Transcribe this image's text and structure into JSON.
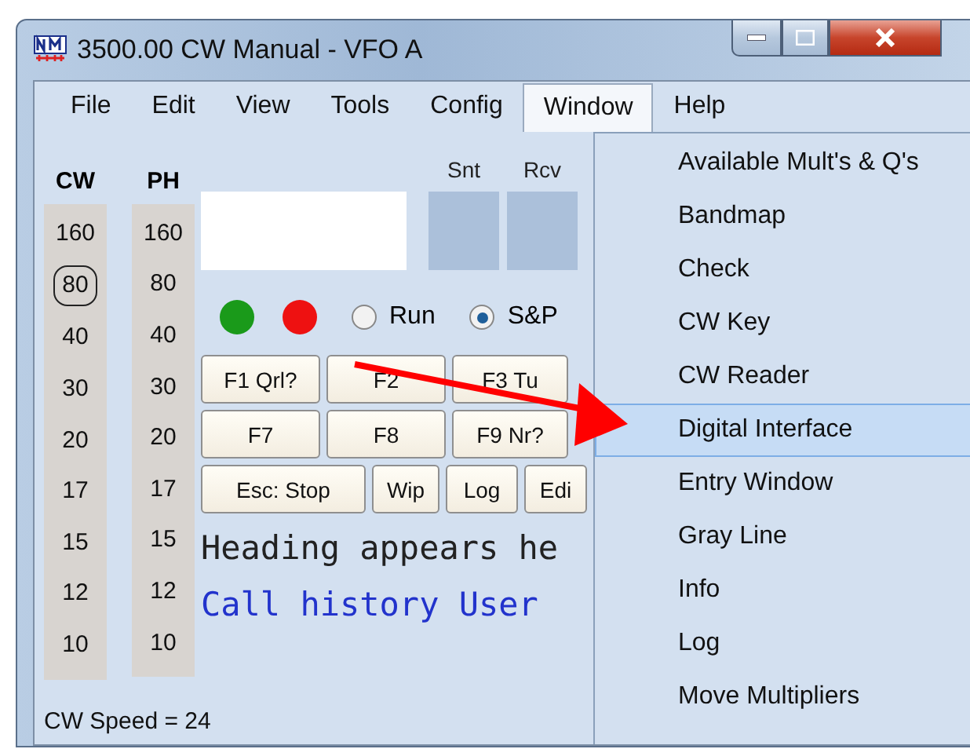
{
  "window": {
    "title": "3500.00 CW Manual - VFO A"
  },
  "menu_bar": [
    {
      "label": "File",
      "selected": false
    },
    {
      "label": "Edit",
      "selected": false
    },
    {
      "label": "View",
      "selected": false
    },
    {
      "label": "Tools",
      "selected": false
    },
    {
      "label": "Config",
      "selected": false
    },
    {
      "label": "Window",
      "selected": true
    },
    {
      "label": "Help",
      "selected": false
    }
  ],
  "band_columns": [
    {
      "header": "CW",
      "bands": [
        {
          "label": "160",
          "selected": false
        },
        {
          "label": "80",
          "selected": true
        },
        {
          "label": "40",
          "selected": false
        },
        {
          "label": "30",
          "selected": false
        },
        {
          "label": "20",
          "selected": false
        },
        {
          "label": "17",
          "selected": false
        },
        {
          "label": "15",
          "selected": false
        },
        {
          "label": "12",
          "selected": false
        },
        {
          "label": "10",
          "selected": false
        }
      ]
    },
    {
      "header": "PH",
      "bands": [
        {
          "label": "160",
          "selected": false
        },
        {
          "label": "80",
          "selected": false
        },
        {
          "label": "40",
          "selected": false
        },
        {
          "label": "30",
          "selected": false
        },
        {
          "label": "20",
          "selected": false
        },
        {
          "label": "17",
          "selected": false
        },
        {
          "label": "15",
          "selected": false
        },
        {
          "label": "12",
          "selected": false
        },
        {
          "label": "10",
          "selected": false
        }
      ]
    }
  ],
  "exchange_fields": [
    {
      "label": "Snt"
    },
    {
      "label": "Rcv"
    }
  ],
  "indicators": [
    {
      "color": "#1a9a1a"
    },
    {
      "color": "#ee1111"
    }
  ],
  "mode_radios": [
    {
      "label": "Run",
      "selected": false
    },
    {
      "label": "S&P",
      "selected": true
    }
  ],
  "function_keys": [
    [
      {
        "label": "F1 Qrl?"
      },
      {
        "label": "F2"
      },
      {
        "label": "F3 Tu"
      }
    ],
    [
      {
        "label": "F7"
      },
      {
        "label": "F8"
      },
      {
        "label": "F9 Nr?"
      }
    ],
    [
      {
        "label": "Esc: Stop"
      },
      {
        "label": "Wip"
      },
      {
        "label": "Log"
      },
      {
        "label": "Edi"
      }
    ]
  ],
  "heading_text": "Heading appears he",
  "call_history_text": "Call history User",
  "status_bar": "CW Speed = 24",
  "window_menu": [
    {
      "label": "Available Mult's & Q's",
      "selected": false
    },
    {
      "label": "Bandmap",
      "selected": false
    },
    {
      "label": "Check",
      "selected": false
    },
    {
      "label": "CW Key",
      "selected": false
    },
    {
      "label": "CW Reader",
      "selected": false
    },
    {
      "label": "Digital Interface",
      "selected": true
    },
    {
      "label": "Entry Window",
      "selected": false
    },
    {
      "label": "Gray Line",
      "selected": false
    },
    {
      "label": "Info",
      "selected": false
    },
    {
      "label": "Log",
      "selected": false
    },
    {
      "label": "Move Multipliers",
      "selected": false
    }
  ]
}
